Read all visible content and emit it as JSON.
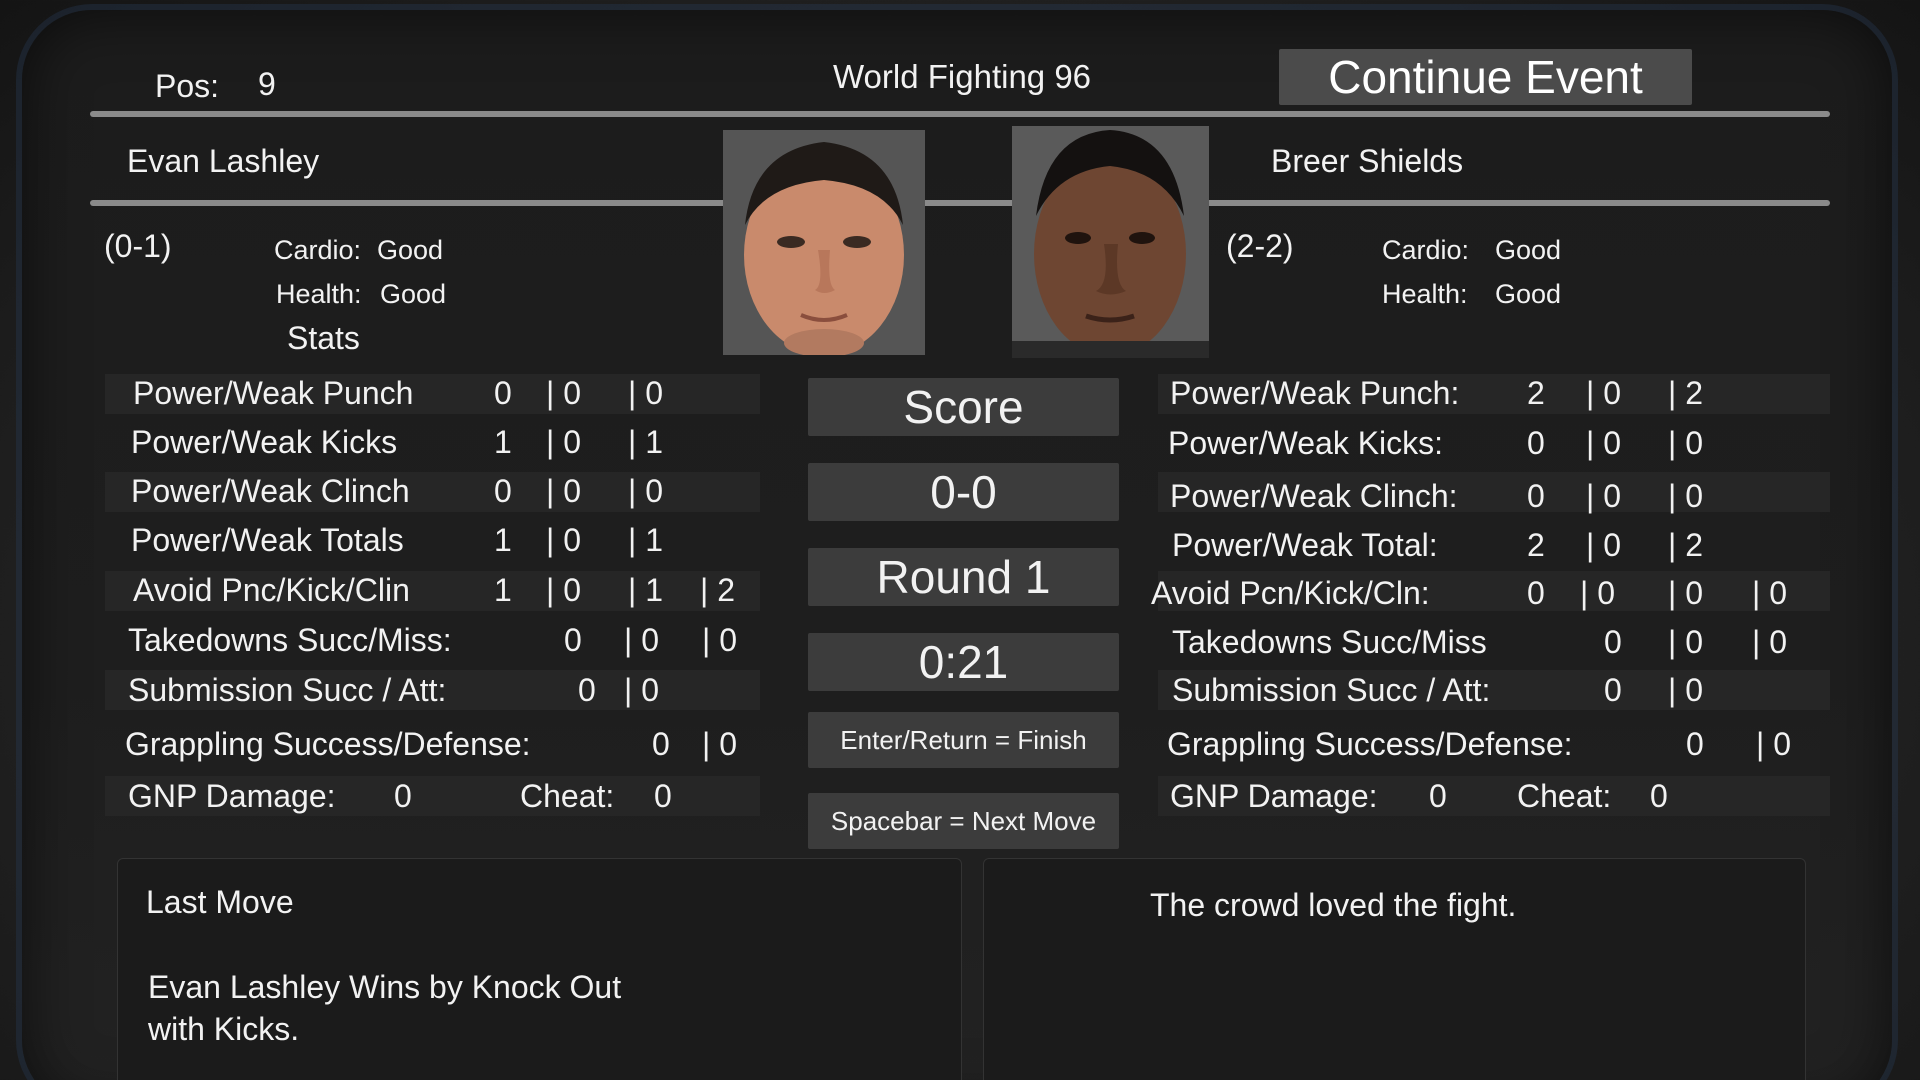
{
  "header": {
    "pos_label": "Pos:",
    "pos_value": "9",
    "event_title": "World Fighting 96",
    "continue_button": "Continue Event"
  },
  "left_fighter": {
    "name": "Evan Lashley",
    "record": "(0-1)",
    "cardio_label": "Cardio:",
    "cardio_value": "Good",
    "health_label": "Health:",
    "health_value": "Good",
    "stats_title": "Stats",
    "stats": [
      {
        "label": "Power/Weak Punch",
        "v1": "0",
        "v2": "| 0",
        "v3": "| 0",
        "v4": ""
      },
      {
        "label": "Power/Weak Kicks",
        "v1": "1",
        "v2": "| 0",
        "v3": "| 1",
        "v4": ""
      },
      {
        "label": "Power/Weak Clinch",
        "v1": "0",
        "v2": "| 0",
        "v3": "| 0",
        "v4": ""
      },
      {
        "label": "Power/Weak Totals",
        "v1": "1",
        "v2": "| 0",
        "v3": "| 1",
        "v4": ""
      },
      {
        "label": "Avoid Pnc/Kick/Clin",
        "v1": "1",
        "v2": "| 0",
        "v3": "| 1",
        "v4": "| 2"
      },
      {
        "label": "Takedowns Succ/Miss:",
        "v1": "0",
        "v2": "| 0",
        "v3": "| 0",
        "v4": ""
      },
      {
        "label": "Submission Succ / Att:",
        "v1": "0",
        "v2": "| 0",
        "v3": "",
        "v4": ""
      },
      {
        "label": "Grappling Success/Defense:",
        "v1": "0",
        "v2": "| 0",
        "v3": "",
        "v4": ""
      }
    ],
    "gnp_label": "GNP Damage:",
    "gnp_value": "0",
    "cheat_label": "Cheat:",
    "cheat_value": "0"
  },
  "right_fighter": {
    "name": "Breer Shields",
    "record": "(2-2)",
    "cardio_label": "Cardio:",
    "cardio_value": "Good",
    "health_label": "Health:",
    "health_value": "Good",
    "stats": [
      {
        "label": "Power/Weak Punch:",
        "v1": "2",
        "v2": "| 0",
        "v3": "| 2",
        "v4": ""
      },
      {
        "label": "Power/Weak Kicks:",
        "v1": "0",
        "v2": "| 0",
        "v3": "| 0",
        "v4": ""
      },
      {
        "label": "Power/Weak Clinch:",
        "v1": "0",
        "v2": "| 0",
        "v3": "| 0",
        "v4": ""
      },
      {
        "label": "Power/Weak Total:",
        "v1": "2",
        "v2": "| 0",
        "v3": "| 2",
        "v4": ""
      },
      {
        "label": "Avoid Pcn/Kick/Cln:",
        "v1": "0",
        "v2": "| 0",
        "v3": "| 0",
        "v4": "| 0"
      },
      {
        "label": "Takedowns Succ/Miss",
        "v1": "0",
        "v2": "| 0",
        "v3": "| 0",
        "v4": ""
      },
      {
        "label": "Submission Succ / Att:",
        "v1": "0",
        "v2": "| 0",
        "v3": "",
        "v4": ""
      },
      {
        "label": "Grappling Success/Defense:",
        "v1": "0",
        "v2": "| 0",
        "v3": "",
        "v4": ""
      }
    ],
    "gnp_label": "GNP Damage:",
    "gnp_value": "0",
    "cheat_label": "Cheat:",
    "cheat_value": "0"
  },
  "center": {
    "score_label": "Score",
    "score_value": "0-0",
    "round": "Round 1",
    "timer": "0:21",
    "enter_hint": "Enter/Return = Finish",
    "space_hint": "Spacebar = Next Move"
  },
  "bottom": {
    "last_move_title": "Last Move",
    "last_move_line1": "Evan Lashley Wins by Knock Out",
    "last_move_line2": "with Kicks.",
    "crowd_text": "The crowd loved the fight."
  }
}
